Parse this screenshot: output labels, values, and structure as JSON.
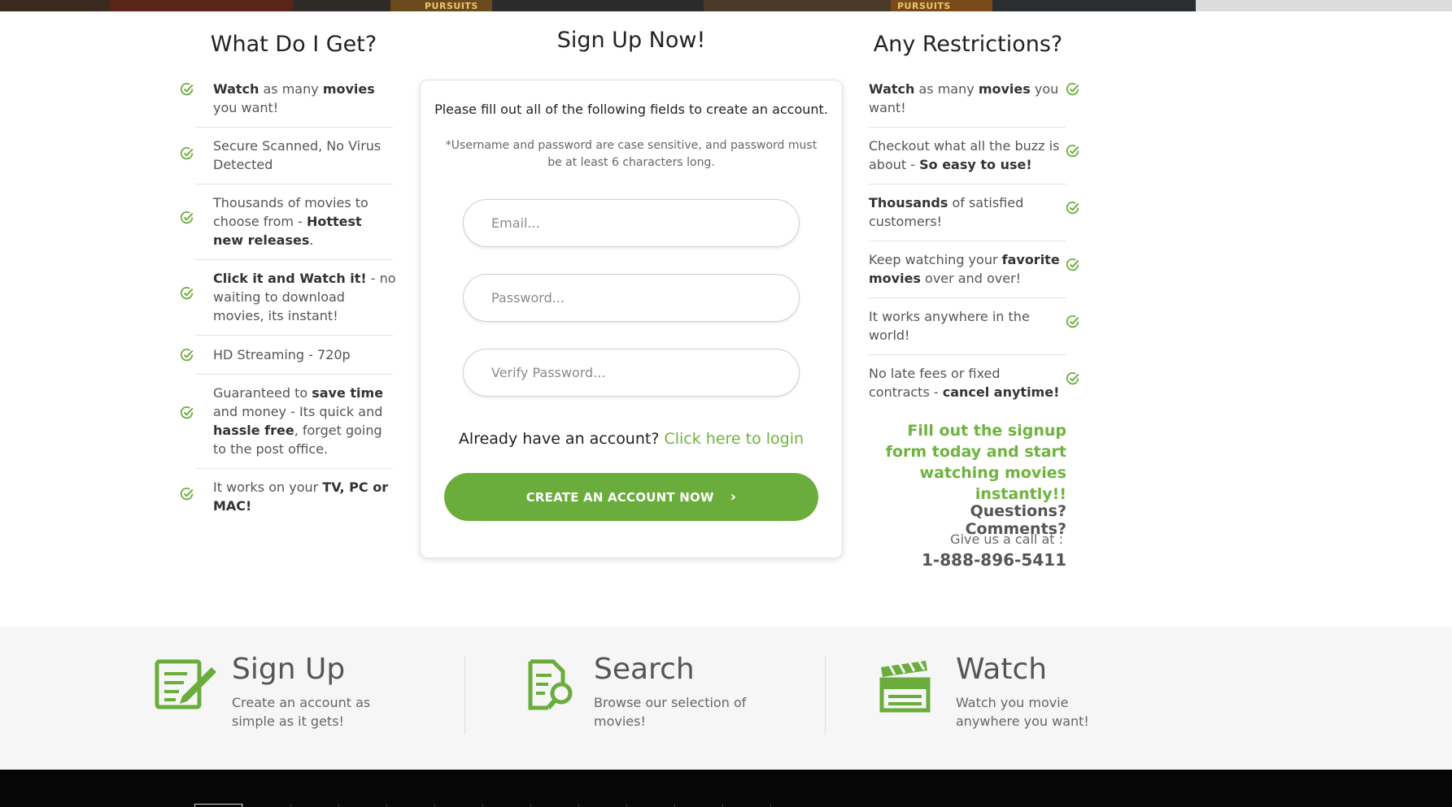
{
  "poster_strip": {
    "labels": [
      "PURSUITS",
      "PURSUITS"
    ]
  },
  "left_column": {
    "title": "What Do I Get?",
    "items": [
      {
        "html": "<b>Watch</b> as many <b>movies</b> you want!"
      },
      {
        "html": "Secure Scanned, No Virus Detected"
      },
      {
        "html": "Thousands of movies to choose from - <b>Hottest new releases</b>."
      },
      {
        "html": "<b>Click it and Watch it!</b> - no waiting to download movies, its instant!"
      },
      {
        "html": "HD Streaming - 720p"
      },
      {
        "html": "Guaranteed to <b>save time</b> and money - Its quick and <b>hassle free</b>, forget going to the post office."
      },
      {
        "html": "It works on your <b>TV, PC or MAC!</b>"
      }
    ]
  },
  "signup": {
    "title": "Sign Up Now!",
    "intro": "Please fill out all of the following fields to create an account.",
    "note": "*Username and password are case sensitive, and password must be at least 6 characters long.",
    "email_placeholder": "Email...",
    "password_placeholder": "Password...",
    "verify_placeholder": "Verify Password...",
    "login_prompt": "Already have an account?",
    "login_link": "Click here to login",
    "create_button": "CREATE AN ACCOUNT NOW",
    "create_chevron": "›"
  },
  "right_column": {
    "title": "Any Restrictions?",
    "items": [
      {
        "html": "<b>Watch</b> as many <b>movies</b> you want!"
      },
      {
        "html": "Checkout what all the buzz is about - <b>So easy to use!</b>"
      },
      {
        "html": "<b>Thousands</b> of satisfied customers!"
      },
      {
        "html": "Keep watching your <b>favorite movies</b> over and over!"
      },
      {
        "html": "It works anywhere in the world!"
      },
      {
        "html": "No late fees or fixed contracts - <b>cancel anytime!</b>"
      }
    ],
    "cta": "Fill out the signup form today and start watching movies instantly!!",
    "questions": "Questions? Comments?",
    "call_text": "Give us a call at :",
    "phone": "1-888-896-5411"
  },
  "steps": [
    {
      "icon": "sign-up-form-icon",
      "title": "Sign Up",
      "desc": "Create an account as simple as it gets!"
    },
    {
      "icon": "search-document-icon",
      "title": "Search",
      "desc": "Browse our selection of movies!"
    },
    {
      "icon": "clapperboard-icon",
      "title": "Watch",
      "desc": "Watch you movie anywhere you want!"
    }
  ],
  "colors": {
    "accent_green": "#6aad3d",
    "link_green": "#6fb33f",
    "footer_black": "#060606",
    "steps_background": "#f6f6f6"
  }
}
